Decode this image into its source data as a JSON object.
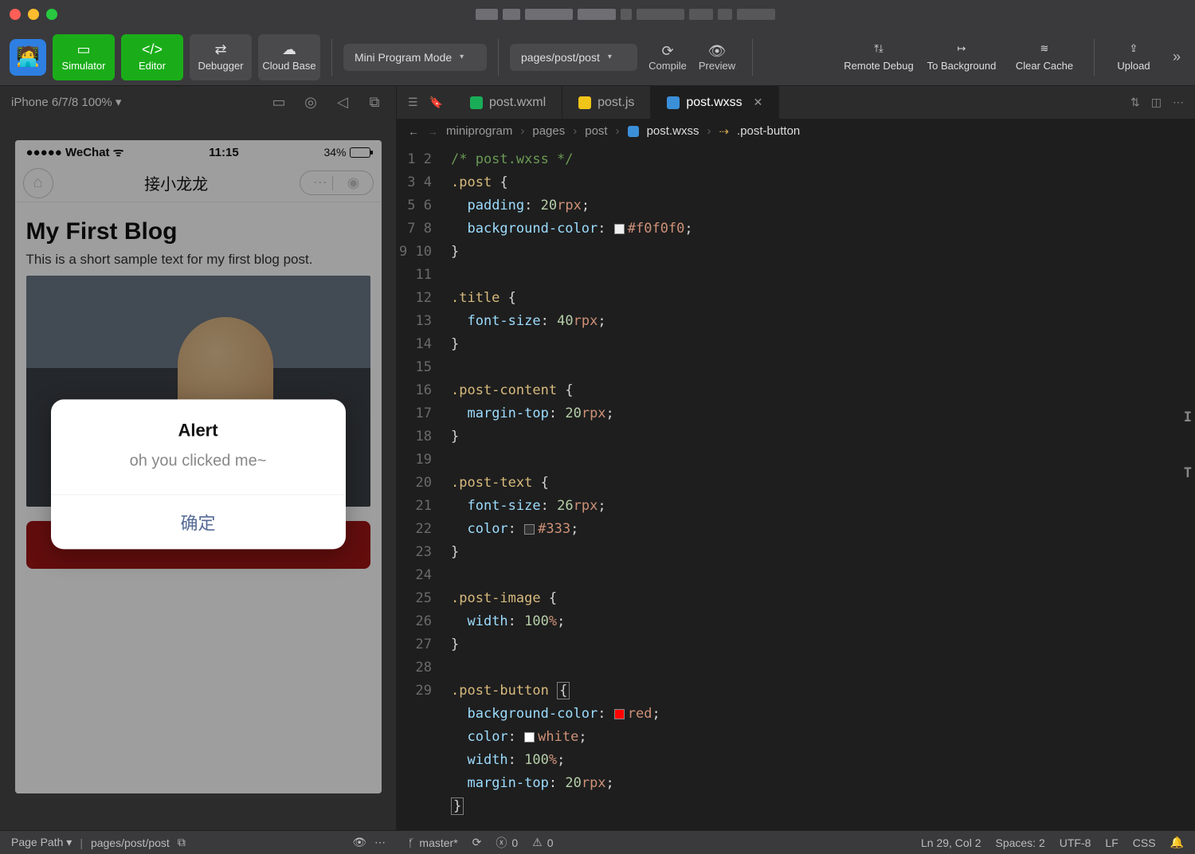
{
  "titlebar": {},
  "toolbar": {
    "simulator": "Simulator",
    "editor": "Editor",
    "debugger": "Debugger",
    "cloud_base": "Cloud Base",
    "mode_label": "Mini Program Mode",
    "page_path": "pages/post/post",
    "compile": "Compile",
    "preview": "Preview",
    "remote_debug": "Remote Debug",
    "to_background": "To Background",
    "clear_cache": "Clear Cache",
    "upload": "Upload"
  },
  "simulator": {
    "device_label": "iPhone 6/7/8 100% ▾",
    "status_carrier": "●●●●● WeChat",
    "status_time": "11:15",
    "status_battery": "34%",
    "nav_title": "接小龙龙",
    "blog_title": "My First Blog",
    "blog_text": "This is a short sample text for my first blog post.",
    "alert_title": "Alert",
    "alert_message": "oh you clicked me~",
    "alert_ok": "确定"
  },
  "tabs": {
    "t1": "post.wxml",
    "t2": "post.js",
    "t3": "post.wxss"
  },
  "breadcrumb": {
    "p1": "miniprogram",
    "p2": "pages",
    "p3": "post",
    "p4": "post.wxss",
    "p5": ".post-button"
  },
  "code": {
    "lines": [
      "/* post.wxss */",
      ".post {",
      "  padding: 20rpx;",
      "  background-color: #f0f0f0;",
      "}",
      "",
      ".title {",
      "  font-size: 40rpx;",
      "}",
      "",
      ".post-content {",
      "  margin-top: 20rpx;",
      "}",
      "",
      ".post-text {",
      "  font-size: 26rpx;",
      "  color: #333;",
      "}",
      "",
      ".post-image {",
      "  width: 100%;",
      "}",
      "",
      ".post-button {",
      "  background-color: red;",
      "  color: white;",
      "  width: 100%;",
      "  margin-top: 20rpx;",
      "}"
    ]
  },
  "sim_footer": {
    "page_path_label": "Page Path ▾",
    "page_path_value": "pages/post/post"
  },
  "statusbar": {
    "branch": "master*",
    "errors": "0",
    "warnings": "0",
    "ln_col": "Ln 29, Col 2",
    "spaces": "Spaces: 2",
    "encoding": "UTF-8",
    "eol": "LF",
    "lang": "CSS"
  }
}
